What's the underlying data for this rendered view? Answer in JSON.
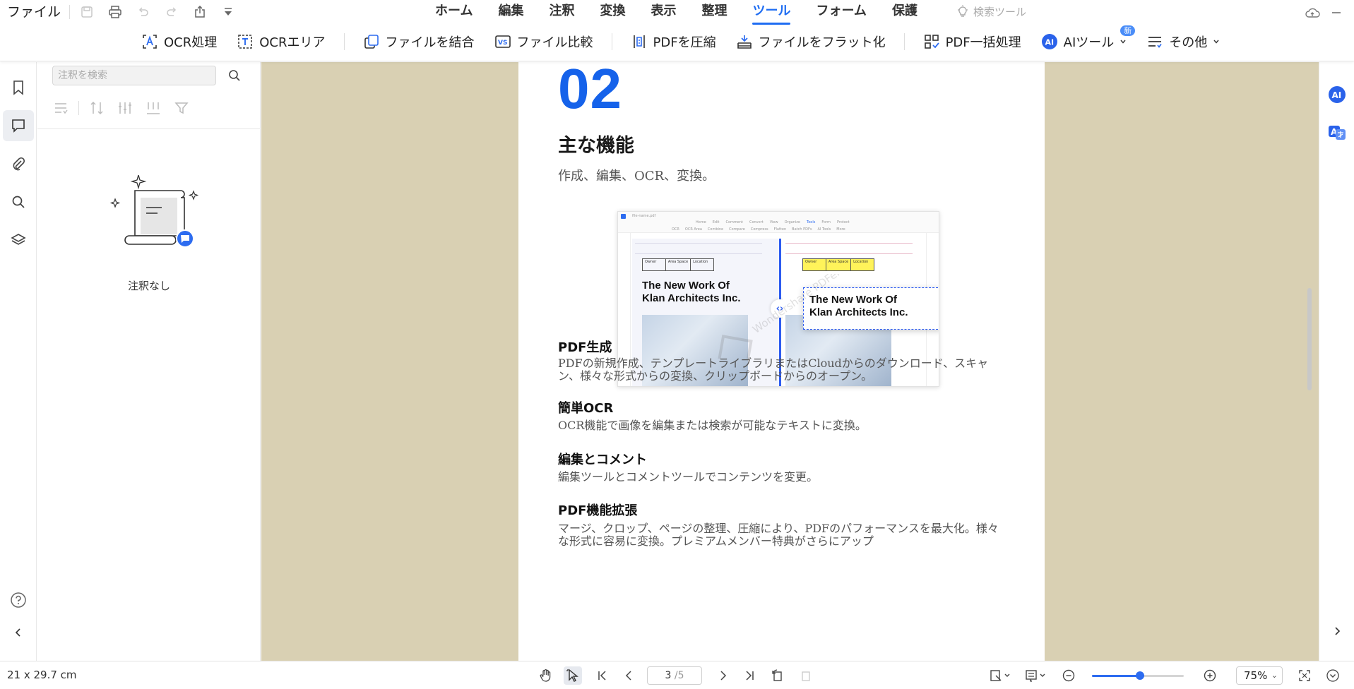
{
  "app": {
    "file_menu": "ファイル",
    "menu_tabs": [
      "ホーム",
      "編集",
      "注釈",
      "変換",
      "表示",
      "整理",
      "ツール",
      "フォーム",
      "保護"
    ],
    "active_tab": "ツール",
    "search_tools": "検索ツール"
  },
  "toolbar": {
    "ocr": "OCR処理",
    "ocr_area": "OCRエリア",
    "combine": "ファイルを結合",
    "compare": "ファイル比較",
    "compress": "PDFを圧縮",
    "flatten": "ファイルをフラット化",
    "batch": "PDF一括処理",
    "ai_tools": "AIツール",
    "ai_badge": "新",
    "more": "その他"
  },
  "annotations": {
    "search_placeholder": "注釈を検索",
    "empty_text": "注釈なし"
  },
  "document": {
    "number": "02",
    "heading": "主な機能",
    "subheading": "作成、編集、OCR、変換。",
    "sections": [
      {
        "title": "PDF生成",
        "body": "PDFの新規作成、テンプレートライブラリまたはCloudからのダウンロード、スキャン、様々な形式からの変換、クリップボードからのオープン。"
      },
      {
        "title": "簡単OCR",
        "body": "OCR機能で画像を編集または検索が可能なテキストに変換。"
      },
      {
        "title": "編集とコメント",
        "body": "編集ツールとコメントツールでコンテンツを変更。"
      },
      {
        "title": "PDF機能拡張",
        "body": "マージ、クロップ、ページの整理、圧縮により、PDFのパフォーマンスを最大化。様々な形式に容易に変換。プレミアムメンバー特典がさらにアップ"
      }
    ],
    "screenshot": {
      "title_left": "The New Work Of\nKlan Architects Inc.",
      "title_right": "The New Work Of\nKlan Architects Inc.",
      "watermark": "Wondershare PDFelement",
      "tab_name": "file-name.pdf",
      "menu": [
        "Home",
        "Edit",
        "Comment",
        "Convert",
        "View",
        "Organize",
        "Tools",
        "Form",
        "Protect"
      ],
      "tools": [
        "OCR",
        "OCR Area",
        "Combine",
        "Compare",
        "Compress",
        "Flatten",
        "Batch PDFs",
        "AI Tools",
        "More"
      ],
      "table_headers": [
        "Owner",
        "Area Space",
        "Location"
      ]
    }
  },
  "status": {
    "dimensions": "21 x 29.7 cm",
    "page_current": "3",
    "page_total": "/5",
    "zoom": "75%",
    "zoom_level": 0.52
  },
  "colors": {
    "accent": "#1f6df2",
    "doc_background": "#d9d0b3",
    "number_blue": "#1562ea"
  }
}
